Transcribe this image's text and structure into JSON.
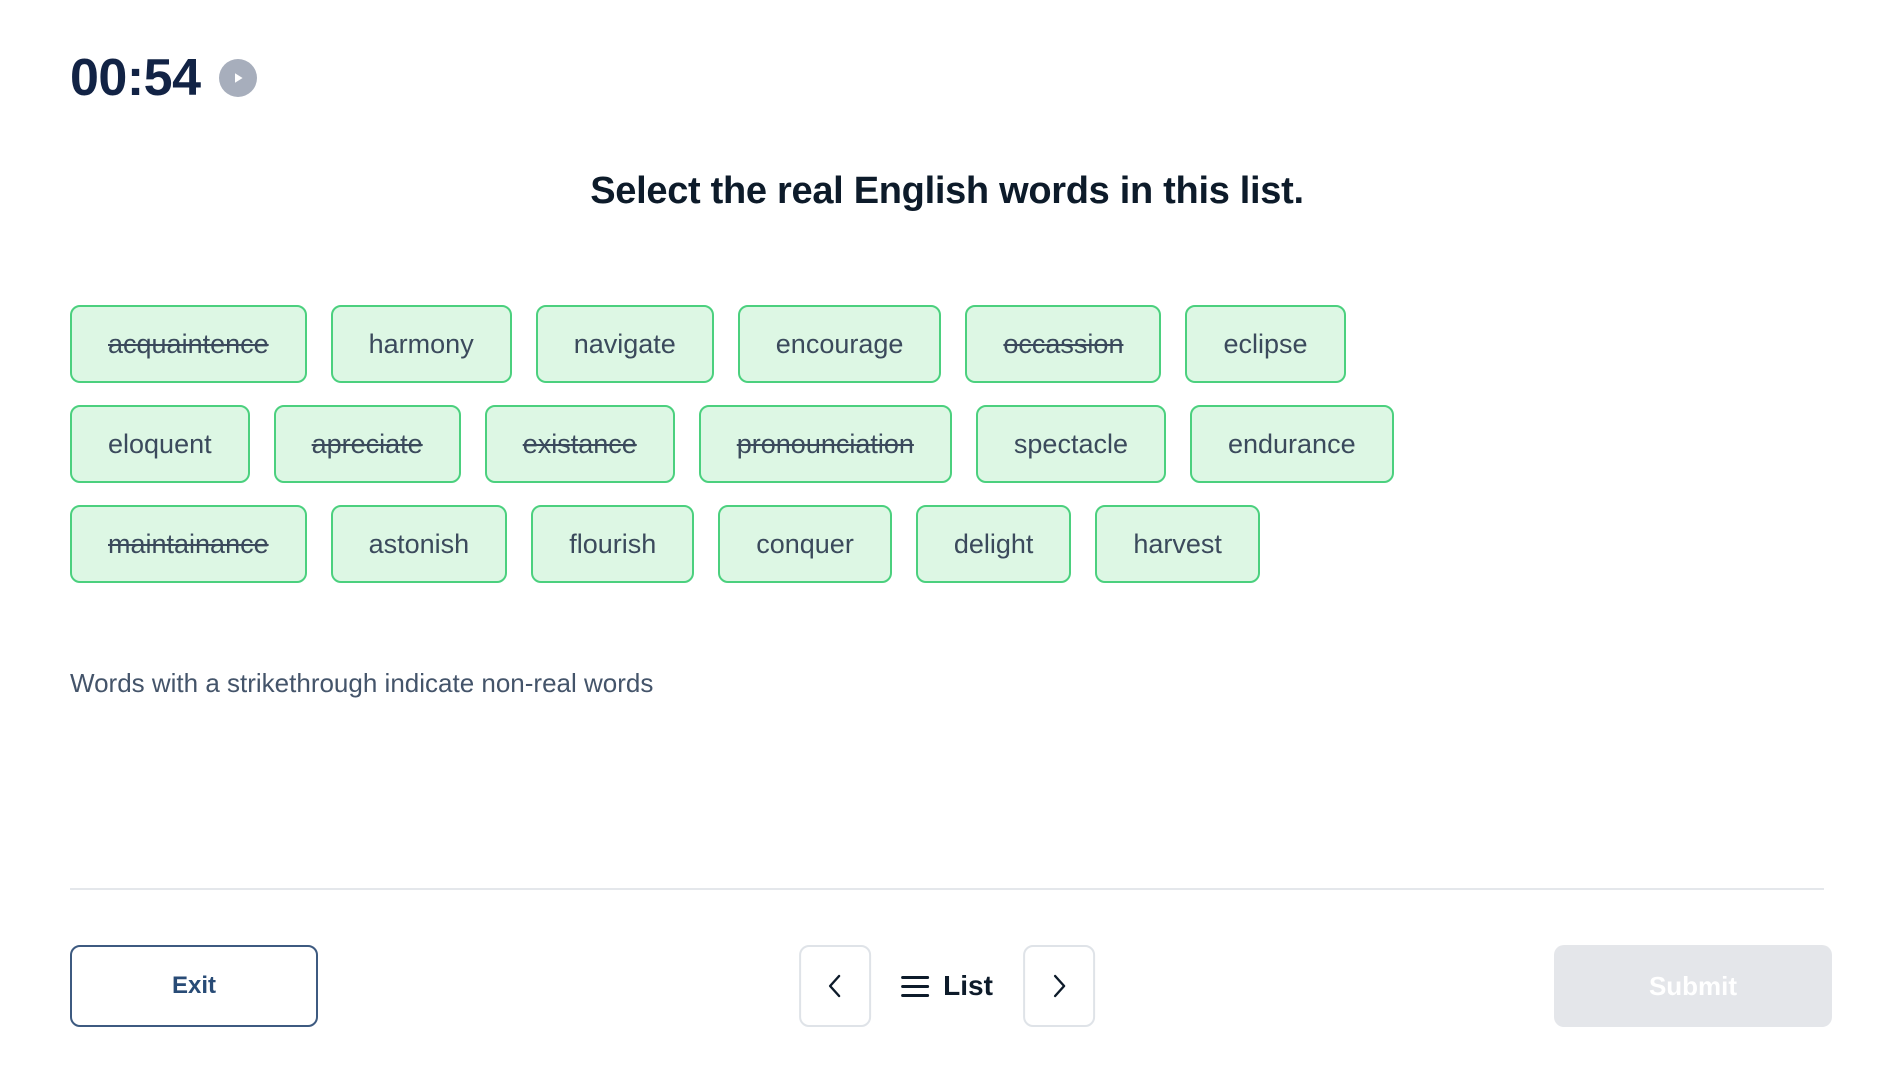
{
  "timer": {
    "value": "00:54",
    "play_icon": "play-icon"
  },
  "prompt": "Select the real English words in this list.",
  "word_rows": [
    [
      {
        "text": "acquaintence",
        "struck": true
      },
      {
        "text": "harmony",
        "struck": false
      },
      {
        "text": "navigate",
        "struck": false
      },
      {
        "text": "encourage",
        "struck": false
      },
      {
        "text": "occassion",
        "struck": true
      },
      {
        "text": "eclipse",
        "struck": false
      }
    ],
    [
      {
        "text": "eloquent",
        "struck": false
      },
      {
        "text": "apreciate",
        "struck": true
      },
      {
        "text": "existance",
        "struck": true
      },
      {
        "text": "pronounciation",
        "struck": true
      },
      {
        "text": "spectacle",
        "struck": false
      },
      {
        "text": "endurance",
        "struck": false
      }
    ],
    [
      {
        "text": "maintainance",
        "struck": true
      },
      {
        "text": "astonish",
        "struck": false
      },
      {
        "text": "flourish",
        "struck": false
      },
      {
        "text": "conquer",
        "struck": false
      },
      {
        "text": "delight",
        "struck": false
      },
      {
        "text": "harvest",
        "struck": false
      }
    ]
  ],
  "caption": "Words with a strikethrough indicate non-real words",
  "footer": {
    "exit_label": "Exit",
    "prev_icon": "chevron-left-icon",
    "next_icon": "chevron-right-icon",
    "list_label": "List",
    "list_icon": "hamburger-menu-icon",
    "submit_label": "Submit"
  },
  "colors": {
    "chip_fill": "#ddf7e4",
    "chip_border": "#4bd07e",
    "chip_text": "#3b4a5c",
    "timer_text": "#122345",
    "play_circle": "#a7aebc",
    "exit_border": "#3d5a80",
    "submit_disabled_bg": "#e4e6ea"
  }
}
